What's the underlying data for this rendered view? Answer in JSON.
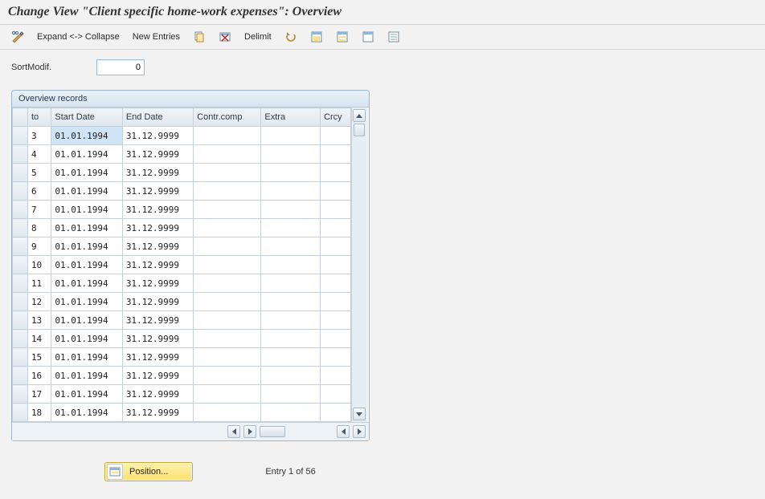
{
  "title": "Change View \"Client specific home-work expenses\": Overview",
  "toolbar": {
    "expand_collapse": "Expand <-> Collapse",
    "new_entries": "New Entries",
    "delimit": "Delimit"
  },
  "sortmodif": {
    "label": "SortModif.",
    "value": "0"
  },
  "panel": {
    "title": "Overview records",
    "columns": {
      "sel": "",
      "to": "to",
      "start": "Start Date",
      "end": "End Date",
      "contr": "Contr.comp",
      "extra": "Extra",
      "crcy": "Crcy"
    },
    "rows": [
      {
        "to": "3",
        "start": "01.01.1994",
        "end": "31.12.9999",
        "contr": "",
        "extra": "",
        "crcy": ""
      },
      {
        "to": "4",
        "start": "01.01.1994",
        "end": "31.12.9999",
        "contr": "",
        "extra": "",
        "crcy": ""
      },
      {
        "to": "5",
        "start": "01.01.1994",
        "end": "31.12.9999",
        "contr": "",
        "extra": "",
        "crcy": ""
      },
      {
        "to": "6",
        "start": "01.01.1994",
        "end": "31.12.9999",
        "contr": "",
        "extra": "",
        "crcy": ""
      },
      {
        "to": "7",
        "start": "01.01.1994",
        "end": "31.12.9999",
        "contr": "",
        "extra": "",
        "crcy": ""
      },
      {
        "to": "8",
        "start": "01.01.1994",
        "end": "31.12.9999",
        "contr": "",
        "extra": "",
        "crcy": ""
      },
      {
        "to": "9",
        "start": "01.01.1994",
        "end": "31.12.9999",
        "contr": "",
        "extra": "",
        "crcy": ""
      },
      {
        "to": "10",
        "start": "01.01.1994",
        "end": "31.12.9999",
        "contr": "",
        "extra": "",
        "crcy": ""
      },
      {
        "to": "11",
        "start": "01.01.1994",
        "end": "31.12.9999",
        "contr": "",
        "extra": "",
        "crcy": ""
      },
      {
        "to": "12",
        "start": "01.01.1994",
        "end": "31.12.9999",
        "contr": "",
        "extra": "",
        "crcy": ""
      },
      {
        "to": "13",
        "start": "01.01.1994",
        "end": "31.12.9999",
        "contr": "",
        "extra": "",
        "crcy": ""
      },
      {
        "to": "14",
        "start": "01.01.1994",
        "end": "31.12.9999",
        "contr": "",
        "extra": "",
        "crcy": ""
      },
      {
        "to": "15",
        "start": "01.01.1994",
        "end": "31.12.9999",
        "contr": "",
        "extra": "",
        "crcy": ""
      },
      {
        "to": "16",
        "start": "01.01.1994",
        "end": "31.12.9999",
        "contr": "",
        "extra": "",
        "crcy": ""
      },
      {
        "to": "17",
        "start": "01.01.1994",
        "end": "31.12.9999",
        "contr": "",
        "extra": "",
        "crcy": ""
      },
      {
        "to": "18",
        "start": "01.01.1994",
        "end": "31.12.9999",
        "contr": "",
        "extra": "",
        "crcy": ""
      }
    ]
  },
  "footer": {
    "position": "Position...",
    "entry": "Entry 1 of 56"
  }
}
